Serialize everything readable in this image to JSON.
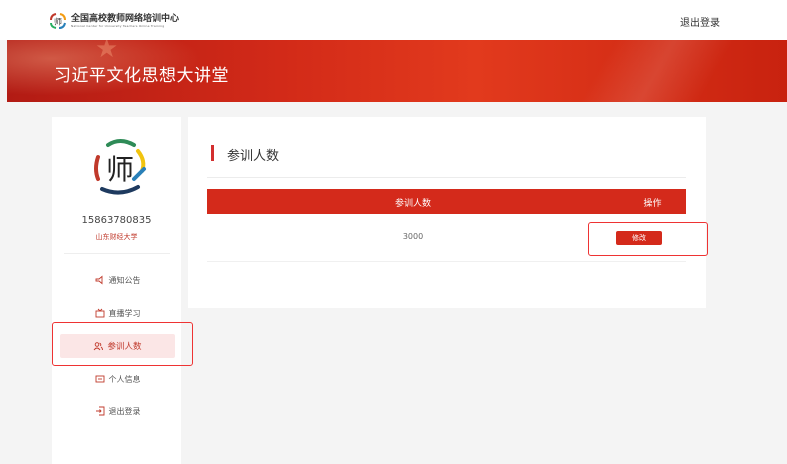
{
  "header": {
    "logo_cn": "全国高校教师网络培训中心",
    "logo_en": "National Center for University Teachers Online Training",
    "logout_label": "退出登录"
  },
  "banner": {
    "title": "习近平文化思想大讲堂"
  },
  "sidebar": {
    "phone": "15863780835",
    "school": "山东财经大学",
    "items": [
      {
        "label": "通知公告",
        "icon": "megaphone-icon"
      },
      {
        "label": "直播学习",
        "icon": "live-icon"
      },
      {
        "label": "参训人数",
        "icon": "users-icon",
        "active": true
      },
      {
        "label": "个人信息",
        "icon": "id-card-icon"
      },
      {
        "label": "退出登录",
        "icon": "exit-icon"
      }
    ]
  },
  "main": {
    "section_title": "参训人数",
    "table": {
      "headers": [
        "参训人数",
        "操作"
      ],
      "rows": [
        {
          "count": "3000",
          "action": "修改"
        }
      ]
    }
  },
  "colors": {
    "accent": "#d42a1b",
    "highlight": "#e33333"
  }
}
